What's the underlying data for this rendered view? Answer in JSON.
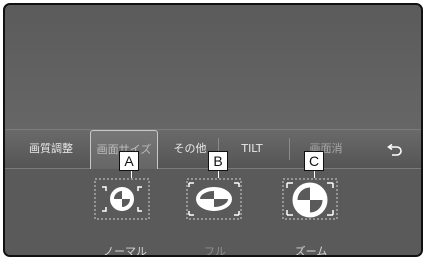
{
  "tabs": [
    {
      "label": "画質調整"
    },
    {
      "label": "画面サイズ"
    },
    {
      "label": "その他"
    },
    {
      "label": "TILT"
    },
    {
      "label": "画面消"
    }
  ],
  "back_symbol": "⮌",
  "callouts": [
    "A",
    "B",
    "C"
  ],
  "modes": [
    {
      "label": "ノーマル"
    },
    {
      "label": "フル"
    },
    {
      "label": "ズーム"
    }
  ],
  "colors": {
    "screen": "#5e5e5e",
    "icon_line": "#ffffff",
    "callout_bg": "#ffffff"
  }
}
